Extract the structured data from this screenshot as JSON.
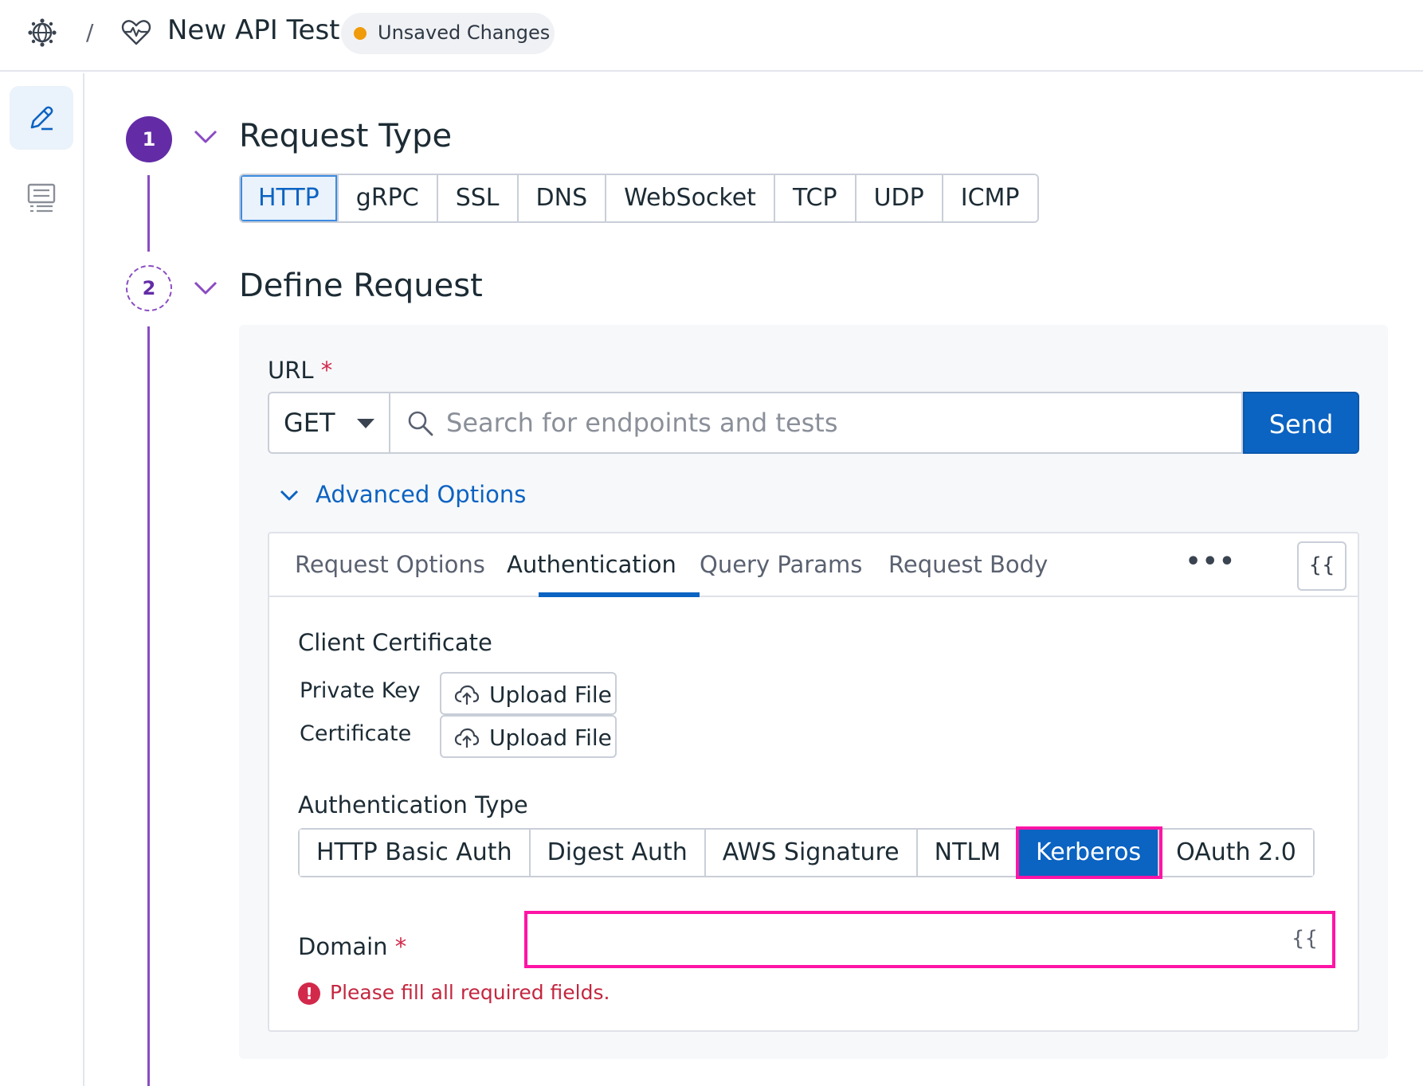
{
  "header": {
    "breadcrumb_separator": "/",
    "title": "New API Test",
    "status_badge": "Unsaved Changes",
    "status_color": "#f09b0a"
  },
  "rail": {
    "items": [
      {
        "icon": "pencil-icon",
        "active": true
      },
      {
        "icon": "list-icon",
        "active": false
      }
    ]
  },
  "steps": [
    {
      "number": "1",
      "title": "Request Type"
    },
    {
      "number": "2",
      "title": "Define Request"
    }
  ],
  "request_types": {
    "items": [
      "HTTP",
      "gRPC",
      "SSL",
      "DNS",
      "WebSocket",
      "TCP",
      "UDP",
      "ICMP"
    ],
    "selected": "HTTP"
  },
  "url": {
    "label": "URL",
    "required_mark": "*",
    "method": "GET",
    "placeholder": "Search for endpoints and tests",
    "value": "",
    "send_label": "Send"
  },
  "advanced": {
    "label": "Advanced Options",
    "tabs": [
      "Request Options",
      "Authentication",
      "Query Params",
      "Request Body"
    ],
    "active_tab": "Authentication",
    "more_label": "•••",
    "variable_button": "{{"
  },
  "auth": {
    "client_certificate_title": "Client Certificate",
    "private_key_label": "Private Key",
    "certificate_label": "Certificate",
    "upload_label": "Upload File",
    "auth_type_title": "Authentication Type",
    "auth_types": [
      "HTTP Basic Auth",
      "Digest Auth",
      "AWS Signature",
      "NTLM",
      "Kerberos",
      "OAuth 2.0"
    ],
    "selected_auth_type": "Kerberos",
    "domain_label": "Domain",
    "domain_value": "",
    "domain_variable": "{{",
    "error_text": "Please fill all required fields."
  },
  "colors": {
    "accent": "#0b63c2",
    "step_purple": "#632ca6",
    "highlight": "#ff14a6",
    "error": "#d2294b"
  }
}
